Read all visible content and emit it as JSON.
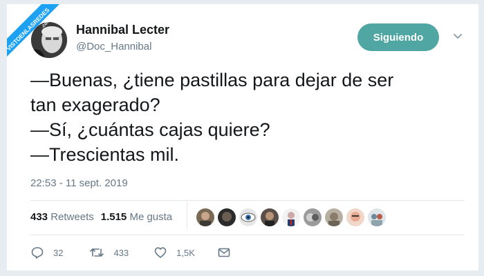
{
  "watermark": {
    "line1": "VISTOENLASREDES",
    "line2": ".com"
  },
  "user": {
    "name": "Hannibal Lecter",
    "handle": "@Doc_Hannibal"
  },
  "follow_button": {
    "label": "Siguiendo",
    "color": "#50a6a3"
  },
  "tweet": {
    "lines": [
      "—Buenas, ¿tiene pastillas para dejar de ser",
      "tan exagerado?",
      "—Sí, ¿cuántas cajas quiere?",
      "—Trescientas mil."
    ],
    "timestamp": "22:53 - 11 sept. 2019"
  },
  "stats": {
    "retweets_count": "433",
    "retweets_label": "Retweets",
    "likes_count": "1.515",
    "likes_label": "Me gusta",
    "liker_avatars": 9
  },
  "actions": {
    "reply": {
      "icon": "reply-icon",
      "count": "32"
    },
    "retweet": {
      "icon": "retweet-icon",
      "count": "433"
    },
    "like": {
      "icon": "heart-icon",
      "count": "1,5K"
    },
    "message": {
      "icon": "envelope-icon"
    }
  },
  "colors": {
    "text": "#14171a",
    "muted": "#657786",
    "background": "#e6ecf0",
    "watermark": "#1da1f2"
  }
}
